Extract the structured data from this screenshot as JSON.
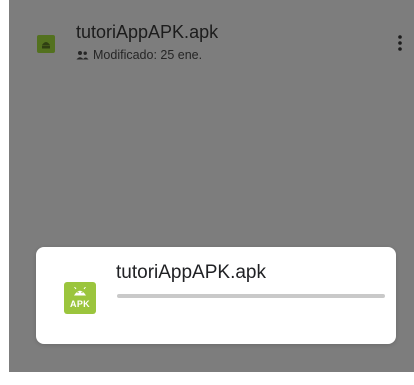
{
  "file_list": {
    "item": {
      "name": "tutoriAppAPK.apk",
      "modified": "Modificado: 25 ene.",
      "shared_icon": "people-icon",
      "thumb_icon": "android-apk-icon",
      "menu_icon": "more-vert-icon"
    }
  },
  "download_dialog": {
    "file_name": "tutoriAppAPK.apk",
    "file_icon_label": "APK",
    "progress_percent": 0
  },
  "colors": {
    "scrim": "#7d7d7d",
    "apk_green": "#9bc53d",
    "progress_track": "#c9c9c9"
  }
}
